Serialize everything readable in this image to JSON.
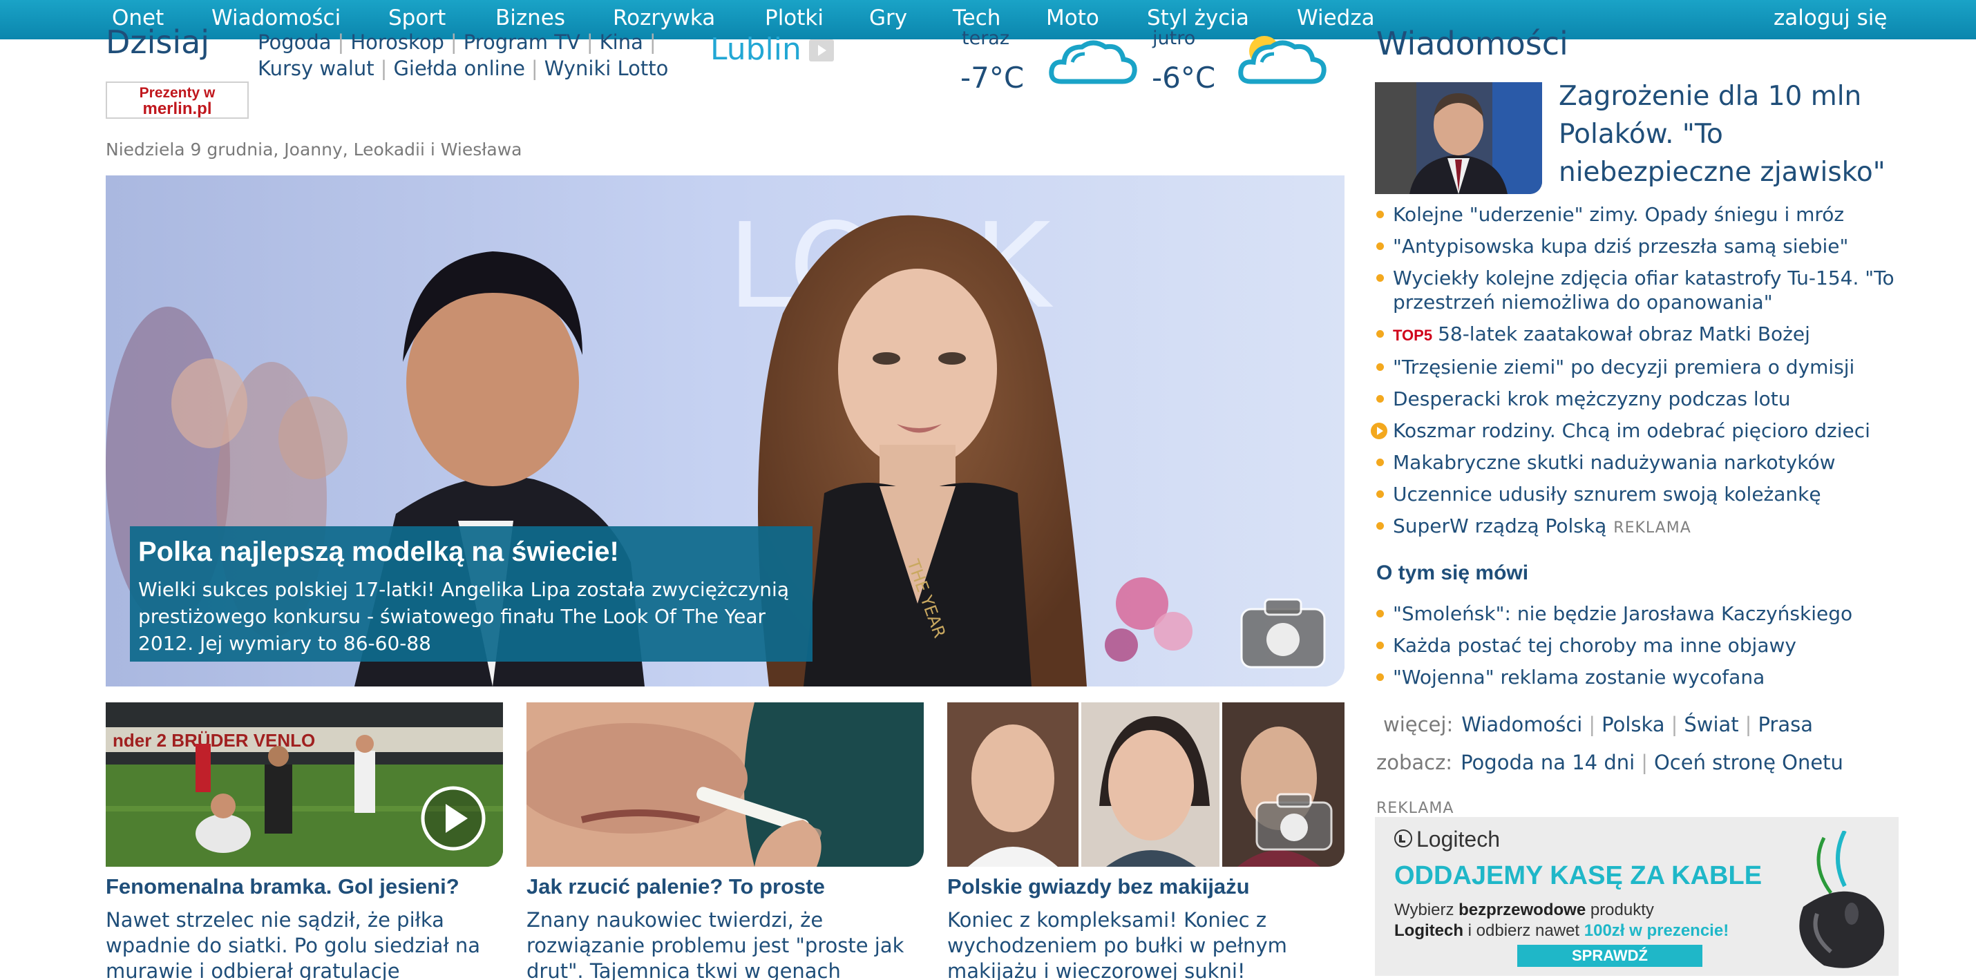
{
  "nav": {
    "items": [
      "Onet",
      "Wiadomości",
      "Sport",
      "Biznes",
      "Rozrywka",
      "Plotki",
      "Gry",
      "Tech",
      "Moto",
      "Styl życia",
      "Wiedza"
    ],
    "login": "zaloguj się"
  },
  "today": {
    "title": "Dzisiaj",
    "links_row1": [
      "Pogoda",
      "Horoskop",
      "Program TV",
      "Kina"
    ],
    "links_row2": [
      "Kursy walut",
      "Giełda online",
      "Wyniki Lotto"
    ],
    "date_line": "Niedziela 9 grudnia, Joanny, Leokadii i Wiesława"
  },
  "merlin_ad": {
    "line1": "Prezenty w",
    "line2": "merlin.pl"
  },
  "city": "Lublin",
  "weather": [
    {
      "label": "teraz",
      "temp": "-7°C",
      "icon": "cloud-icon"
    },
    {
      "label": "jutro",
      "temp": "-6°C",
      "icon": "sun-cloud-icon"
    }
  ],
  "hero": {
    "title": "Polka najlepszą modelką na świecie!",
    "text": "Wielki sukces polskiej 17-latki! Angelika Lipa została zwyciężczynią prestiżowego konkursu - światowego finału The Look Of The Year 2012. Jej wymiary to 86-60-88",
    "backdrop_text": "LOOK",
    "sash_text": "THE YEAR",
    "badge_icon": "camera-icon"
  },
  "cards": [
    {
      "title": "Fenomenalna bramka. Gol jesieni?",
      "text": "Nawet strzelec nie sądził, że piłka wpadnie do siatki. Po golu siedział na murawie i odbierał gratulacje",
      "badge_icon": "play-icon",
      "ad_text": "nder 2 BRÜDER VENLO"
    },
    {
      "title": "Jak rzucić palenie? To proste",
      "text": "Znany naukowiec twierdzi, że rozwiązanie problemu jest \"proste jak drut\". Tajemnica tkwi w genach"
    },
    {
      "title": "Polskie gwiazdy bez makijażu",
      "text": "Koniec z kompleksami! Koniec z wychodzeniem po bułki w pełnym makijażu i wieczorowej sukni!",
      "badge_icon": "camera-icon"
    }
  ],
  "news": {
    "heading": "Wiadomości",
    "lead": "Zagrożenie dla 10 mln Polaków. \"To niebezpieczne zjawisko\"",
    "items": [
      {
        "text": "Kolejne \"uderzenie\" zimy. Opady śniegu i mróz"
      },
      {
        "text": "\"Antypisowska kupa dziś przeszła samą siebie\""
      },
      {
        "text": "Wyciekły kolejne zdjęcia ofiar katastrofy Tu-154. \"To przestrzeń niemożliwa do opanowania\""
      },
      {
        "badge": "TOP5",
        "text": "58-latek zaatakował obraz Matki Bożej"
      },
      {
        "text": "\"Trzęsienie ziemi\" po decyzji premiera o dymisji"
      },
      {
        "text": "Desperacki krok mężczyzny podczas lotu"
      },
      {
        "text": "Koszmar rodziny. Chcą im odebrać pięcioro dzieci",
        "video": true
      },
      {
        "text": "Makabryczne skutki nadużywania narkotyków"
      },
      {
        "text": "Uczennice udusiły sznurem swoją koleżankę"
      },
      {
        "text": "SuperW rządzą Polską",
        "ad": "REKLAMA"
      }
    ],
    "talk_heading": "O tym się mówi",
    "talk_items": [
      "\"Smoleńsk\": nie będzie Jarosława Kaczyńskiego",
      "Każda postać tej choroby ma inne objawy",
      "\"Wojenna\" reklama zostanie wycofana"
    ],
    "more_label": "więcej:",
    "more_links": [
      "Wiadomości",
      "Polska",
      "Świat",
      "Prasa"
    ],
    "see_label": "zobacz:",
    "see_links": [
      "Pogoda na 14 dni",
      "Oceń stronę Onetu"
    ]
  },
  "logitech_ad": {
    "label": "REKLAMA",
    "brand": "Logitech",
    "headline": "ODDAJEMY KASĘ ZA KABLE",
    "line_a": "Wybierz ",
    "line_b": "bezprzewodowe",
    "line_c": " produkty",
    "line_d": "Logitech",
    "line_e": " i odbierz nawet ",
    "line_f": "100zł w prezencie!",
    "button": "SPRAWDŹ"
  }
}
